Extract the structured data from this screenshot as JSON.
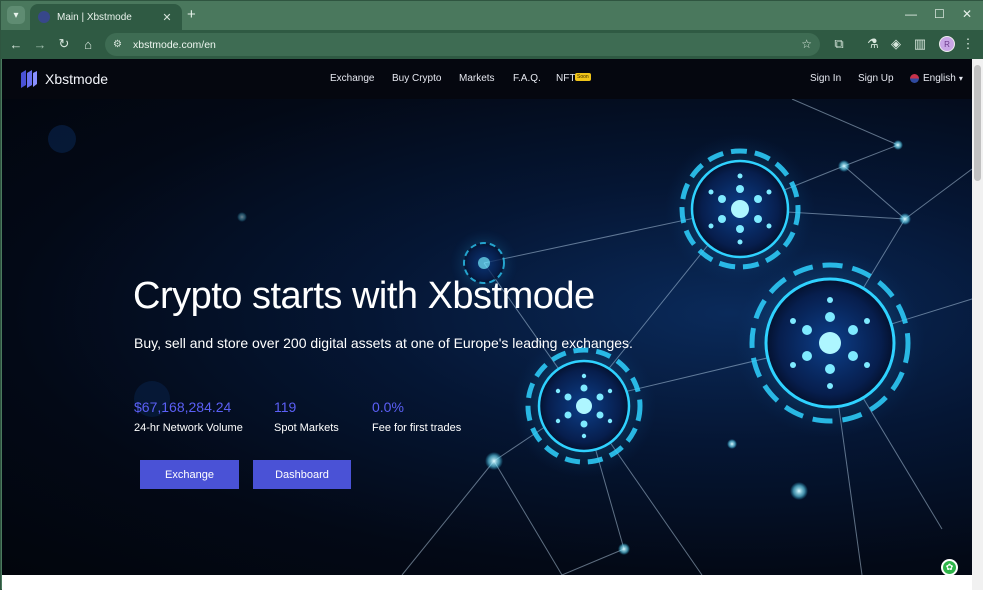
{
  "browser": {
    "tab_title": "Main | Xbstmode",
    "url": "xbstmode.com/en",
    "profile_initial": "R"
  },
  "site": {
    "brand": "Xbstmode",
    "nav": [
      {
        "label": "Exchange"
      },
      {
        "label": "Buy Crypto"
      },
      {
        "label": "Markets"
      },
      {
        "label": "F.A.Q."
      },
      {
        "label": "NFT",
        "badge": "Soon"
      }
    ],
    "auth": {
      "sign_in": "Sign In",
      "sign_up": "Sign Up"
    },
    "language": "English"
  },
  "hero": {
    "title": "Crypto starts with Xbstmode",
    "subtitle": "Buy, sell and store over 200 digital assets at one of Europe's leading exchanges.",
    "stats": [
      {
        "value": "$67,168,284.24",
        "label": "24-hr Network Volume"
      },
      {
        "value": "119",
        "label": "Spot Markets"
      },
      {
        "value": "0.0%",
        "label": "Fee for first trades"
      }
    ],
    "buttons": {
      "exchange": "Exchange",
      "dashboard": "Dashboard"
    }
  },
  "colors": {
    "accent": "#4a52d6",
    "stat_value": "#5b5ff5",
    "browser_frame": "#4a785d",
    "glow": "#2fd2ff"
  }
}
